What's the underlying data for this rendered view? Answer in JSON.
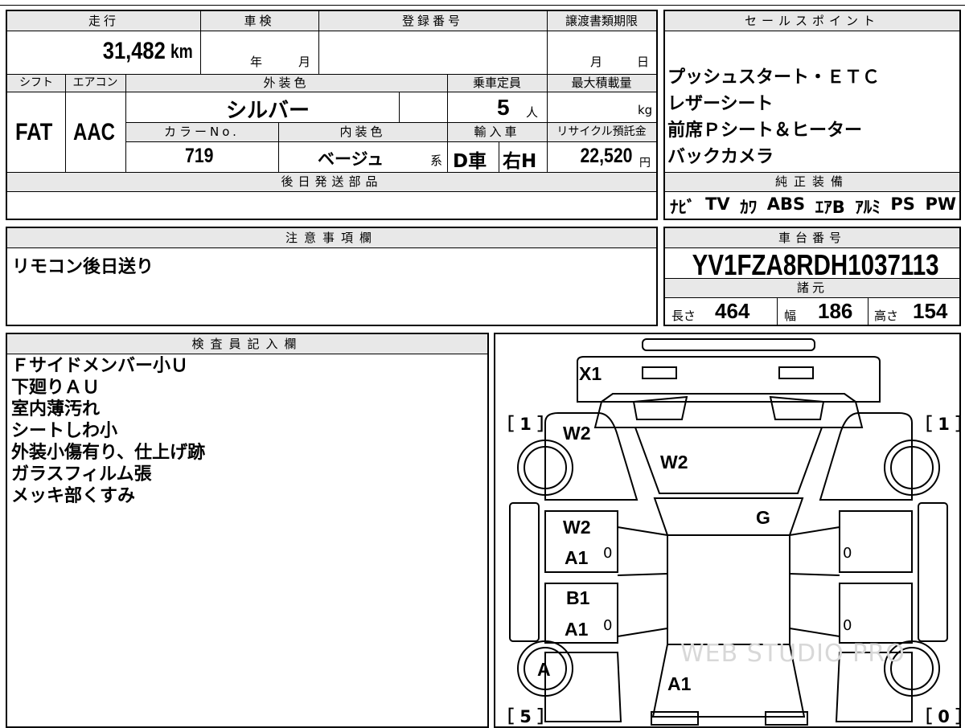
{
  "vehicle_info": {
    "headers": {
      "mileage": "走行",
      "inspection": "車検",
      "registration": "登録番号",
      "transfer_deadline": "譲渡書類期限",
      "shift": "シフト",
      "aircon": "エアコン",
      "exterior_color": "外装色",
      "capacity": "乗車定員",
      "max_load": "最大積載量",
      "color_no": "カラーNo.",
      "interior_color": "内装色",
      "import": "輸入車",
      "recycle": "リサイクル預託金",
      "later_parts": "後日発送部品"
    },
    "mileage_value": "31,482",
    "mileage_unit": "km",
    "inspection_year": "年",
    "inspection_month": "月",
    "transfer_month": "月",
    "transfer_day": "日",
    "shift_value": "FAT",
    "aircon_value": "AAC",
    "exterior_color_value": "シルバー",
    "capacity_value": "5",
    "capacity_unit": "人",
    "max_load_unit": "kg",
    "color_no_value": "719",
    "interior_color_value": "ベージュ",
    "interior_suffix": "系",
    "import_type": "D車",
    "steering": "右H",
    "recycle_value": "22,520",
    "recycle_unit": "円"
  },
  "sales_points": {
    "header": "セールスポイント",
    "items": [
      "プッシュスタート・ＥＴＣ",
      "レザーシート",
      "前席Ｐシート＆ヒーター",
      "バックカメラ"
    ]
  },
  "genuine_equipment": {
    "header": "純正装備",
    "items": [
      "ﾅﾋﾞ",
      "TV",
      "ｶﾜ",
      "ABS",
      "ｴｱB",
      "ｱﾙﾐ",
      "PS",
      "PW"
    ]
  },
  "notes": {
    "header": "注意事項欄",
    "text": "リモコン後日送り"
  },
  "chassis": {
    "header": "車台番号",
    "number": "YV1FZA8RDH1037113",
    "spec_header": "諸元",
    "length_label": "長さ",
    "length": "464",
    "width_label": "幅",
    "width": "186",
    "height_label": "高さ",
    "height": "154"
  },
  "inspector": {
    "header": "検査員記入欄",
    "lines": [
      "Ｆサイドメンバー小Ｕ",
      "下廻りＡＵ",
      "室内薄汚れ",
      "シートしわ小",
      "外装小傷有り、仕上げ跡",
      "ガラスフィルム張",
      "メッキ部くすみ"
    ]
  },
  "diagram": {
    "marks": {
      "front_bumper": "X1",
      "hood_side": "W2",
      "windshield": "W2",
      "front_door_l": "W2",
      "front_door_l2": "A1",
      "rear_door_l": "B1",
      "rear_door_l2": "A1",
      "roof": "G",
      "rear_wheel": "A",
      "rear": "A1"
    },
    "zeros": [
      "0",
      "0",
      "0",
      "0"
    ],
    "corner_labels": [
      "［ 1 ］",
      "［ 1 ］",
      "［ 5 ］",
      "［ 0 ］"
    ],
    "watermark": "WEB STUDIO PRO"
  }
}
